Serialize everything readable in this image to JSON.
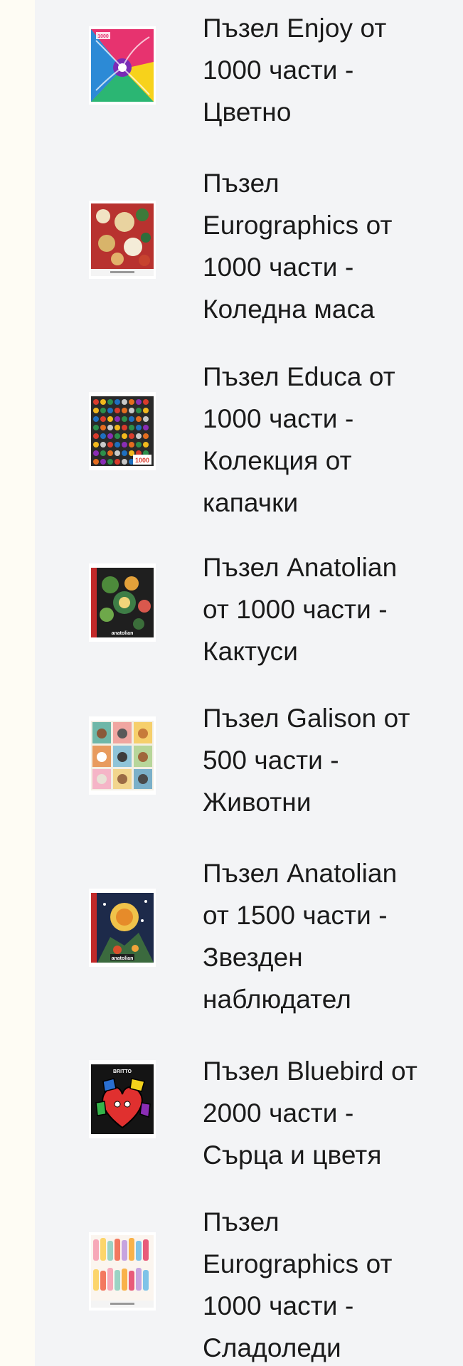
{
  "products": [
    {
      "title": "Пъзел Enjoy от\n1000 части -\nЦветно",
      "thumbnail": "puzzle-box-colorful-feathers",
      "image_label": "1000"
    },
    {
      "title": "Пъзел\nEurographics от\n1000 части -\nКоледна маса",
      "thumbnail": "puzzle-box-christmas-table"
    },
    {
      "title": "Пъзел Educa от\n1000 части -\nКолекция от\nкапачки",
      "thumbnail": "puzzle-box-bottle-caps",
      "image_label": "1000"
    },
    {
      "title": "Пъзел Anatolian\nот 1000 части -\nКактуси",
      "thumbnail": "puzzle-box-cacti",
      "image_label": "anatolian"
    },
    {
      "title": "Пъзел Galison от\n500 части -\nЖивотни",
      "thumbnail": "puzzle-box-animals"
    },
    {
      "title": "Пъзел Anatolian\nот 1500 части -\nЗвезден\nнаблюдател",
      "thumbnail": "puzzle-box-stargazer",
      "image_label": "anatolian"
    },
    {
      "title": "Пъзел Bluebird от\n2000 части -\nСърца и цветя",
      "thumbnail": "puzzle-box-hearts-flowers",
      "image_label": "BRITTO"
    },
    {
      "title": "Пъзел\nEurographics от\n1000 части -\nСладоледи",
      "thumbnail": "puzzle-box-ice-creams"
    }
  ]
}
